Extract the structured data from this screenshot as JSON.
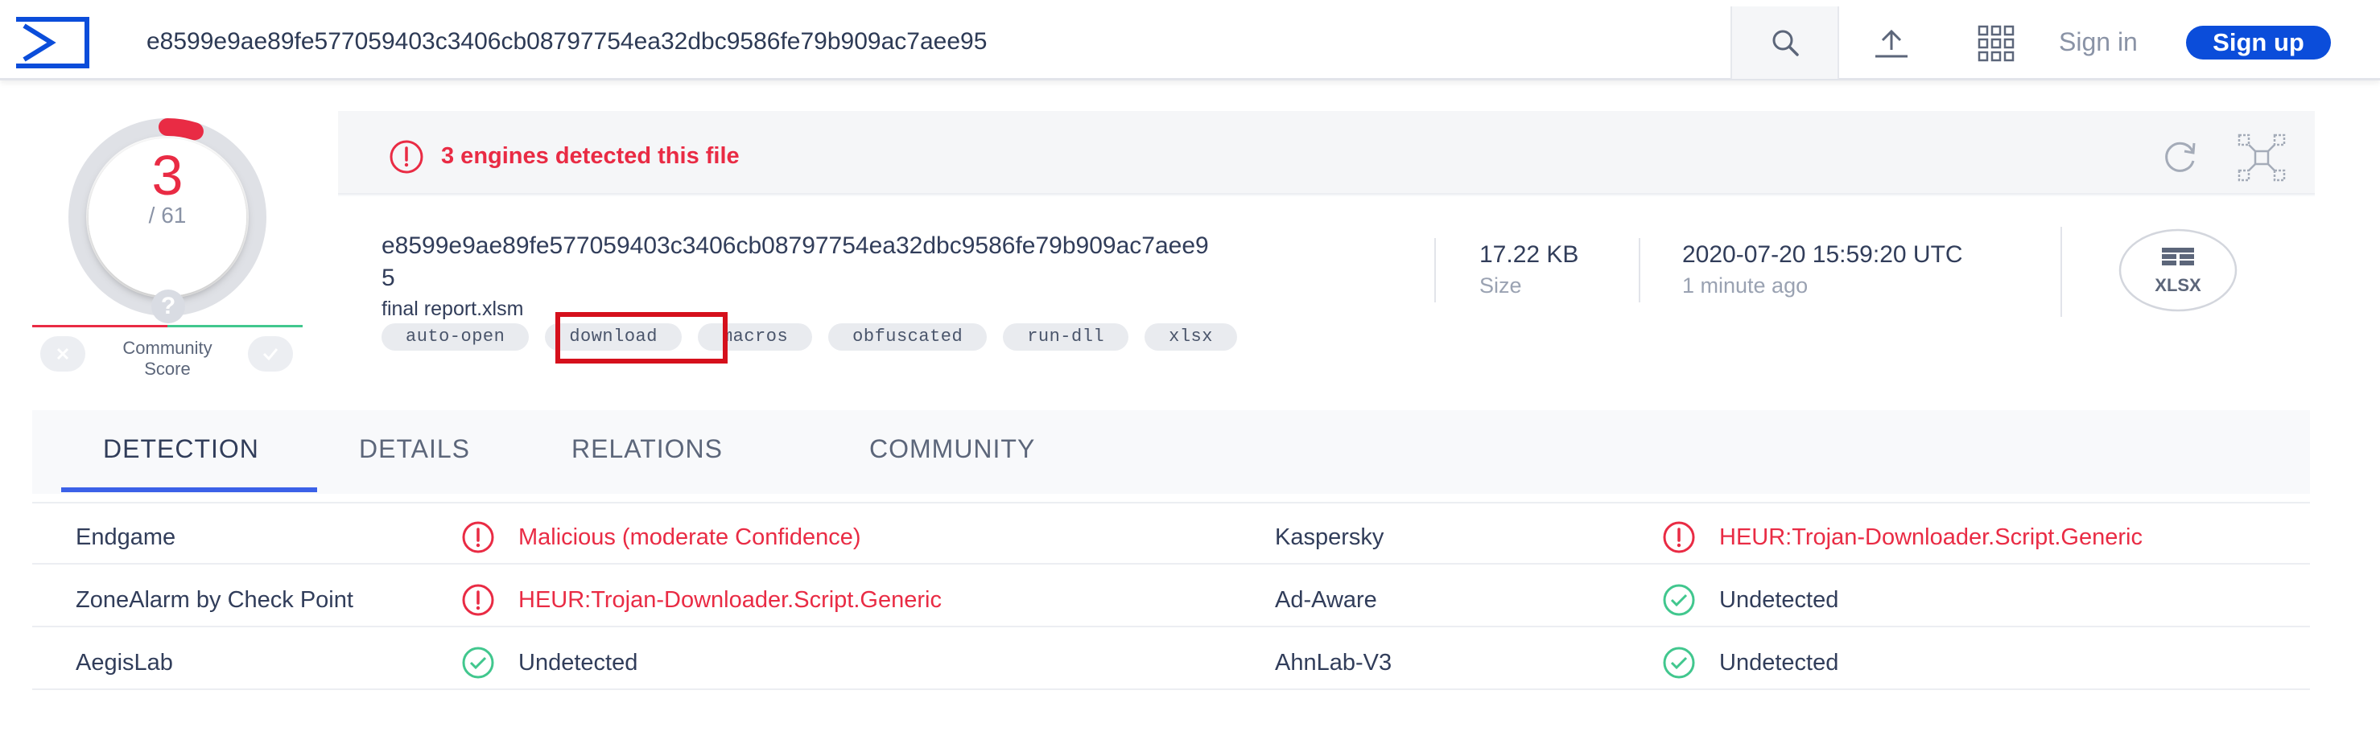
{
  "search": {
    "query": "e8599e9ae89fe577059403c3406cb08797754ea32dbc9586fe79b909ac7aee95"
  },
  "topbar": {
    "sign_in": "Sign in",
    "sign_up": "Sign up"
  },
  "score": {
    "detected": "3",
    "total": "/ 61",
    "detected_fraction": 0.049,
    "community_label_1": "Community",
    "community_label_2": "Score",
    "community_q": "?"
  },
  "summary": {
    "alert": "3 engines detected this file",
    "hash_line1": "e8599e9ae89fe577059403c3406cb08797754ea32dbc9586fe79b909ac7aee9",
    "hash_line2": "5",
    "file_name": "final report.xlsm",
    "tags": [
      "auto-open",
      "download",
      "macros",
      "obfuscated",
      "run-dll",
      "xlsx"
    ],
    "highlighted_tag": "download",
    "size_value": "17.22 KB",
    "size_label": "Size",
    "date_value": "2020-07-20 15:59:20 UTC",
    "date_label": "1 minute ago",
    "file_type": "XLSX"
  },
  "tabs": [
    {
      "label": "DETECTION",
      "active": true
    },
    {
      "label": "DETAILS",
      "active": false
    },
    {
      "label": "RELATIONS",
      "active": false
    },
    {
      "label": "COMMUNITY",
      "active": false
    }
  ],
  "detections": [
    {
      "left": {
        "engine": "Endgame",
        "result": "Malicious (moderate Confidence)",
        "status": "malicious"
      },
      "right": {
        "engine": "Kaspersky",
        "result": "HEUR:Trojan-Downloader.Script.Generic",
        "status": "malicious"
      }
    },
    {
      "left": {
        "engine": "ZoneAlarm by Check Point",
        "result": "HEUR:Trojan-Downloader.Script.Generic",
        "status": "malicious"
      },
      "right": {
        "engine": "Ad-Aware",
        "result": "Undetected",
        "status": "clean"
      }
    },
    {
      "left": {
        "engine": "AegisLab",
        "result": "Undetected",
        "status": "clean"
      },
      "right": {
        "engine": "AhnLab-V3",
        "result": "Undetected",
        "status": "clean"
      }
    }
  ],
  "colors": {
    "brand": "#0b4dda",
    "malicious": "#e92b44",
    "clean": "#41c78e",
    "tab_active": "#3b61e8",
    "highlight_box": "#d5101c"
  },
  "icons": {
    "logo": "virustotal-sigma-logo",
    "search": "search-icon",
    "upload": "upload-icon",
    "apps": "apps-grid-icon",
    "reanalyze": "reanalyze-icon",
    "graph": "graph-icon",
    "alert": "alert-circle-icon",
    "clean": "check-circle-icon",
    "file": "xlsx-file-icon"
  }
}
